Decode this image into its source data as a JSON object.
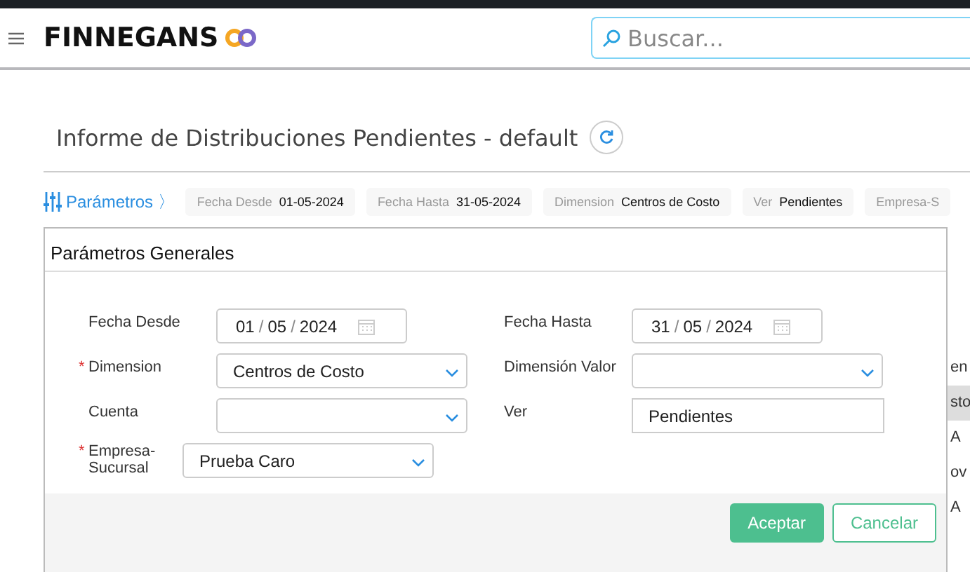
{
  "header": {
    "logo": "FINNEGANS",
    "search": {
      "placeholder": "Buscar..."
    }
  },
  "page": {
    "title": "Informe de Distribuciones Pendientes - default"
  },
  "filters": {
    "toggle": "Parámetros",
    "toggle_arrow": "〉",
    "chips": [
      {
        "label": "Fecha Desde",
        "value": "01-05-2024"
      },
      {
        "label": "Fecha Hasta",
        "value": "31-05-2024"
      },
      {
        "label": "Dimension",
        "value": "Centros de Costo"
      },
      {
        "label": "Ver",
        "value": "Pendientes"
      },
      {
        "label": "Empresa-S"
      }
    ]
  },
  "background_column": [
    "en",
    "sto",
    "A",
    "ov",
    "A"
  ],
  "dialog": {
    "title": "Parámetros Generales",
    "required_mark": "*",
    "date_separator": "/",
    "fields": [
      {
        "label": "Fecha Desde",
        "kind": "date",
        "required": false,
        "day": "01",
        "month": "05",
        "year": "2024"
      },
      {
        "label": "Fecha Hasta",
        "kind": "date",
        "required": false,
        "day": "31",
        "month": "05",
        "year": "2024"
      },
      {
        "label": "Dimension",
        "kind": "select",
        "required": true,
        "value": "Centros de Costo"
      },
      {
        "label": "Dimensión Valor",
        "kind": "select",
        "required": false
      },
      {
        "label": "Cuenta",
        "kind": "select",
        "required": false
      },
      {
        "label": "Ver",
        "kind": "text",
        "required": false,
        "value": "Pendientes"
      },
      {
        "label": "Empresa-Sucursal",
        "kind": "select",
        "required": true,
        "value": "Prueba Caro"
      }
    ],
    "buttons": [
      {
        "label": "Aceptar",
        "kind": "primary"
      },
      {
        "label": "Cancelar",
        "kind": "secondary"
      }
    ]
  }
}
